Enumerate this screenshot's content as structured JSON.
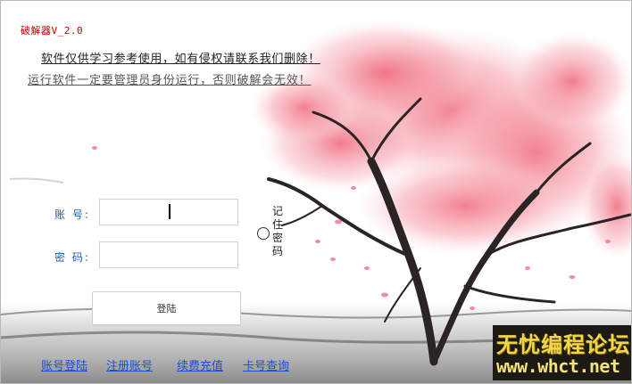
{
  "window": {
    "title": "破解器V_2.0"
  },
  "notices": {
    "line1": "软件仅供学习参考使用，如有侵权请联系我们删除！",
    "line2": "运行软件一定要管理员身份运行，否则破解会无效！"
  },
  "form": {
    "account_label": "账 号:",
    "account_value": "",
    "password_label": "密 码:",
    "password_value": "",
    "remember_label": "记住密码",
    "remember_checked": false,
    "login_button": "登陆"
  },
  "links": {
    "account_login": "账号登陆",
    "register": "注册账号",
    "renew": "续费充值",
    "card_query": "卡号查询"
  },
  "watermark": {
    "name": "无忧编程论坛",
    "url": "www.whct.net"
  },
  "colors": {
    "title_red": "#cc0000",
    "label_blue": "#1a5fb4",
    "link_blue": "#1a4fd6",
    "blossom_pink": "#f08a96"
  }
}
